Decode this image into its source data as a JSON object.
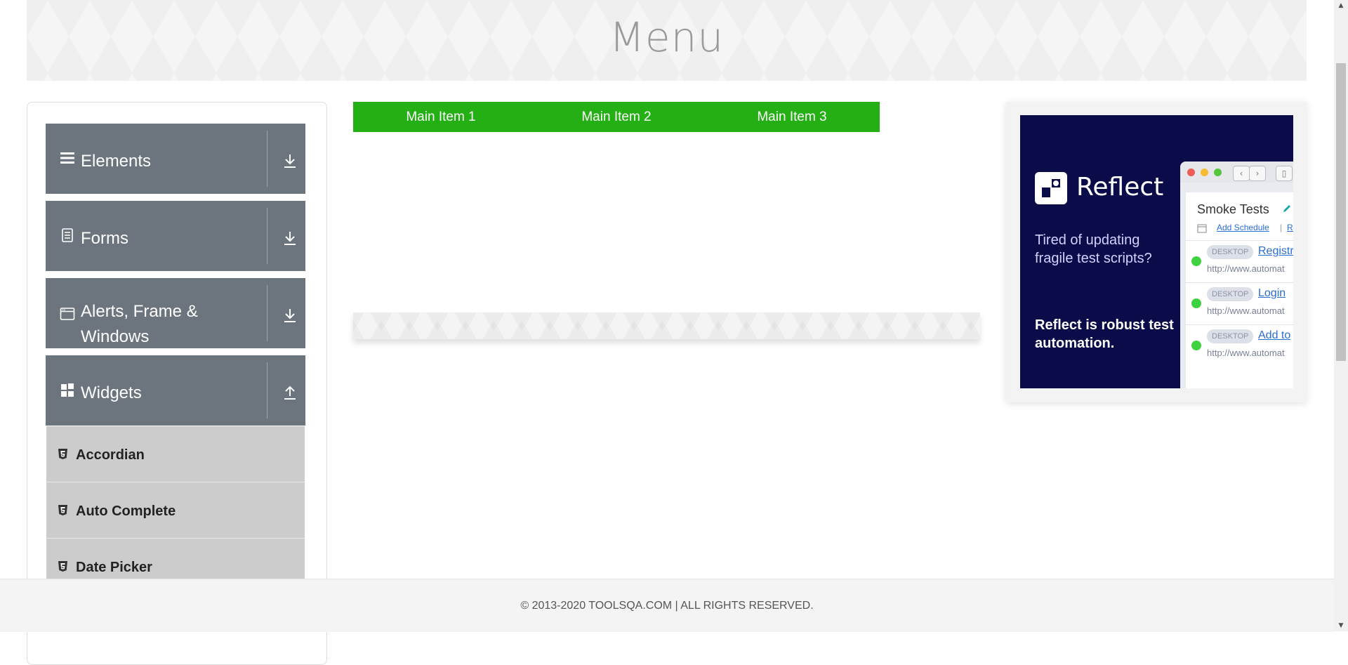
{
  "header": {
    "title": "Menu"
  },
  "sidebar": {
    "groups": [
      {
        "label": "Elements",
        "icon": "hamburger-icon",
        "arrow": "download-arrow-icon"
      },
      {
        "label": "Forms",
        "icon": "document-icon",
        "arrow": "download-arrow-icon"
      },
      {
        "label_line1": "Alerts, Frame &",
        "label_line2": "Windows",
        "icon": "window-icon",
        "arrow": "download-arrow-icon"
      },
      {
        "label": "Widgets",
        "icon": "widgets-icon",
        "arrow": "upload-arrow-icon"
      }
    ],
    "widget_items": [
      "Accordian",
      "Auto Complete",
      "Date Picker"
    ]
  },
  "menu": {
    "items": [
      "Main Item 1",
      "Main Item 2",
      "Main Item 3"
    ],
    "color": "#24af15"
  },
  "ad": {
    "brand": "Reflect",
    "copy1": "Tired of updating fragile test scripts?",
    "copy2": "Reflect is robust test automation.",
    "mock": {
      "title": "Smoke Tests",
      "schedule_link": "Add Schedule",
      "pipe": "|",
      "truncated_link": "Ru",
      "rows": [
        {
          "tag": "DESKTOP",
          "name": "Registr",
          "url": "http://www.automat"
        },
        {
          "tag": "DESKTOP",
          "name": "Login",
          "url": "http://www.automat"
        },
        {
          "tag": "DESKTOP",
          "name": "Add to",
          "url": "http://www.automat"
        }
      ]
    }
  },
  "footer": {
    "text": "© 2013-2020 TOOLSQA.COM | ALL RIGHTS RESERVED."
  },
  "scrollbar": {
    "up": "▲",
    "down": "▼"
  }
}
